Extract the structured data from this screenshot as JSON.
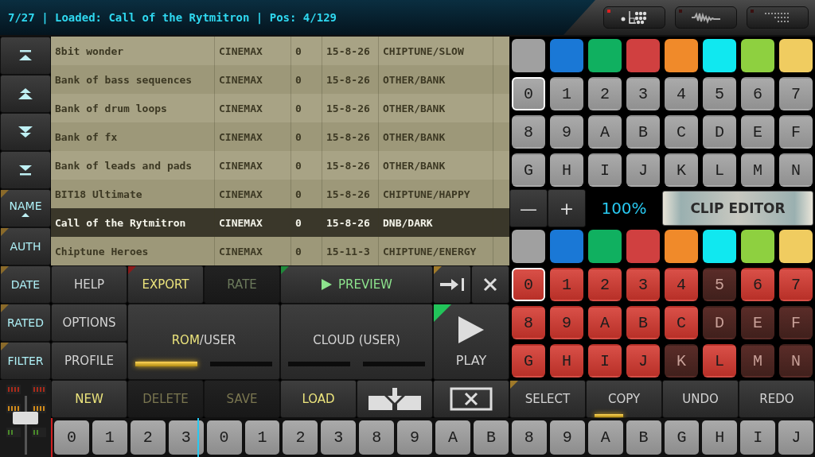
{
  "status_text": "7/27 | Loaded: Call of the Rytmitron | Pos: 4/129",
  "top_buttons": [
    {
      "kind": "pads",
      "active": true
    },
    {
      "kind": "wave",
      "active": false
    },
    {
      "kind": "dots",
      "active": false
    }
  ],
  "nav_buttons": [
    {
      "kind": "first"
    },
    {
      "kind": "pageup"
    },
    {
      "kind": "pagedown"
    },
    {
      "kind": "last"
    },
    {
      "kind": "sort",
      "label": "NAME",
      "sorted": true
    },
    {
      "kind": "sort",
      "label": "AUTH",
      "sorted": false
    },
    {
      "kind": "sort",
      "label": "DATE",
      "sorted": false
    },
    {
      "kind": "sort",
      "label": "RATED",
      "sorted": false
    },
    {
      "kind": "sort",
      "label": "FILTER",
      "sorted": false
    }
  ],
  "list_rows": [
    {
      "name": "8bit wonder",
      "author": "CINEMAX",
      "rating": "0",
      "date": "15-8-26",
      "category": "CHIPTUNE/SLOW",
      "selected": false
    },
    {
      "name": "Bank of bass sequences",
      "author": "CINEMAX",
      "rating": "0",
      "date": "15-8-26",
      "category": "OTHER/BANK",
      "selected": false
    },
    {
      "name": "Bank of drum loops",
      "author": "CINEMAX",
      "rating": "0",
      "date": "15-8-26",
      "category": "OTHER/BANK",
      "selected": false
    },
    {
      "name": "Bank of fx",
      "author": "CINEMAX",
      "rating": "0",
      "date": "15-8-26",
      "category": "OTHER/BANK",
      "selected": false
    },
    {
      "name": "Bank of leads and pads",
      "author": "CINEMAX",
      "rating": "0",
      "date": "15-8-26",
      "category": "OTHER/BANK",
      "selected": false
    },
    {
      "name": "BIT18 Ultimate",
      "author": "CINEMAX",
      "rating": "0",
      "date": "15-8-26",
      "category": "CHIPTUNE/HAPPY",
      "selected": false
    },
    {
      "name": "Call of the Rytmitron",
      "author": "CINEMAX",
      "rating": "0",
      "date": "15-8-26",
      "category": "DNB/DARK",
      "selected": true
    },
    {
      "name": "Chiptune Heroes",
      "author": "CINEMAX",
      "rating": "0",
      "date": "15-11-3",
      "category": "CHIPTUNE/ENERGY",
      "selected": false
    }
  ],
  "controls": [
    {
      "kind": "text",
      "label": "HELP",
      "disabled": false,
      "highlighted": false
    },
    {
      "kind": "text",
      "label": "EXPORT",
      "disabled": false,
      "highlighted": true,
      "color": "#8a1a1a"
    },
    {
      "kind": "text",
      "label": "RATE",
      "disabled": true,
      "highlighted": false
    },
    {
      "kind": "preview",
      "label": "PREVIEW",
      "color": "#1f8a3a"
    },
    {
      "kind": "toend",
      "color": "#a07a2a"
    },
    {
      "kind": "close"
    },
    {
      "kind": "text",
      "label": "OPTIONS",
      "disabled": false,
      "highlighted": false
    },
    {
      "kind": "text",
      "label": "PROFILE",
      "disabled": false,
      "highlighted": false
    },
    {
      "kind": "source",
      "parts": [
        {
          "text": "ROM",
          "highlighted": true
        },
        {
          "text": "/USER",
          "highlighted": false
        }
      ],
      "indicators": [
        true,
        false
      ]
    },
    {
      "kind": "source",
      "parts": [
        {
          "text": "CLOUD (USER)",
          "highlighted": false
        }
      ],
      "indicators": [
        false,
        false
      ]
    },
    {
      "kind": "play",
      "label": "PLAY",
      "color": "#22c45a"
    },
    {
      "kind": "text",
      "label": "NEW",
      "disabled": false,
      "highlighted": true
    },
    {
      "kind": "text",
      "label": "DELETE",
      "disabled": true,
      "highlighted": true
    },
    {
      "kind": "text",
      "label": "SAVE",
      "disabled": true,
      "highlighted": true
    },
    {
      "kind": "text",
      "label": "LOAD",
      "disabled": false,
      "highlighted": true
    },
    {
      "kind": "download"
    },
    {
      "kind": "closebox"
    }
  ],
  "upper_colors": [
    {
      "color": "#a0a0a0"
    },
    {
      "color": "#1a78d6"
    },
    {
      "color": "#10b060"
    },
    {
      "color": "#d04040"
    },
    {
      "color": "#f08a2a"
    },
    {
      "color": "#10e8f0"
    },
    {
      "color": "#8ed040"
    },
    {
      "color": "#f0cc60"
    }
  ],
  "upper_pads": [
    {
      "label": "0",
      "selected": true
    },
    {
      "label": "1",
      "selected": false
    },
    {
      "label": "2",
      "selected": false
    },
    {
      "label": "3",
      "selected": false
    },
    {
      "label": "4",
      "selected": false
    },
    {
      "label": "5",
      "selected": false
    },
    {
      "label": "6",
      "selected": false
    },
    {
      "label": "7",
      "selected": false
    },
    {
      "label": "8",
      "selected": false
    },
    {
      "label": "9",
      "selected": false
    },
    {
      "label": "A",
      "selected": false
    },
    {
      "label": "B",
      "selected": false
    },
    {
      "label": "C",
      "selected": false
    },
    {
      "label": "D",
      "selected": false
    },
    {
      "label": "E",
      "selected": false
    },
    {
      "label": "F",
      "selected": false
    },
    {
      "label": "G",
      "selected": false
    },
    {
      "label": "H",
      "selected": false
    },
    {
      "label": "I",
      "selected": false
    },
    {
      "label": "J",
      "selected": false
    },
    {
      "label": "K",
      "selected": false
    },
    {
      "label": "L",
      "selected": false
    },
    {
      "label": "M",
      "selected": false
    },
    {
      "label": "N",
      "selected": false
    }
  ],
  "zoom": {
    "minus": "—",
    "plus": "+",
    "value": "100%",
    "clip_editor": "CLIP EDITOR"
  },
  "lower_colors": [
    {
      "color": "#a0a0a0"
    },
    {
      "color": "#1a78d6"
    },
    {
      "color": "#10b060"
    },
    {
      "color": "#d04040"
    },
    {
      "color": "#f08a2a"
    },
    {
      "color": "#10e8f0"
    },
    {
      "color": "#8ed040"
    },
    {
      "color": "#f0cc60"
    }
  ],
  "lower_pads": [
    {
      "label": "0",
      "selected": true,
      "on": true
    },
    {
      "label": "1",
      "selected": false,
      "on": true
    },
    {
      "label": "2",
      "selected": false,
      "on": true
    },
    {
      "label": "3",
      "selected": false,
      "on": true
    },
    {
      "label": "4",
      "selected": false,
      "on": true
    },
    {
      "label": "5",
      "selected": false,
      "on": false
    },
    {
      "label": "6",
      "selected": false,
      "on": true
    },
    {
      "label": "7",
      "selected": false,
      "on": true
    },
    {
      "label": "8",
      "selected": false,
      "on": true
    },
    {
      "label": "9",
      "selected": false,
      "on": true
    },
    {
      "label": "A",
      "selected": false,
      "on": true
    },
    {
      "label": "B",
      "selected": false,
      "on": true
    },
    {
      "label": "C",
      "selected": false,
      "on": true
    },
    {
      "label": "D",
      "selected": false,
      "on": false
    },
    {
      "label": "E",
      "selected": false,
      "on": false
    },
    {
      "label": "F",
      "selected": false,
      "on": false
    },
    {
      "label": "G",
      "selected": false,
      "on": true
    },
    {
      "label": "H",
      "selected": false,
      "on": true
    },
    {
      "label": "I",
      "selected": false,
      "on": true
    },
    {
      "label": "J",
      "selected": false,
      "on": true
    },
    {
      "label": "K",
      "selected": false,
      "on": false
    },
    {
      "label": "L",
      "selected": false,
      "on": true
    },
    {
      "label": "M",
      "selected": false,
      "on": false
    },
    {
      "label": "N",
      "selected": false,
      "on": false
    }
  ],
  "edit_buttons": [
    {
      "label": "SELECT",
      "color": "#a07a2a",
      "lit": false
    },
    {
      "label": "COPY",
      "lit": true
    },
    {
      "label": "UNDO",
      "lit": false
    },
    {
      "label": "REDO",
      "lit": false
    }
  ],
  "sequence": [
    "0",
    "1",
    "2",
    "3",
    "0",
    "1",
    "2",
    "3",
    "8",
    "9",
    "A",
    "B",
    "8",
    "9",
    "A",
    "B",
    "G",
    "H",
    "I",
    "J"
  ],
  "playhead": {
    "level": 0.19
  }
}
